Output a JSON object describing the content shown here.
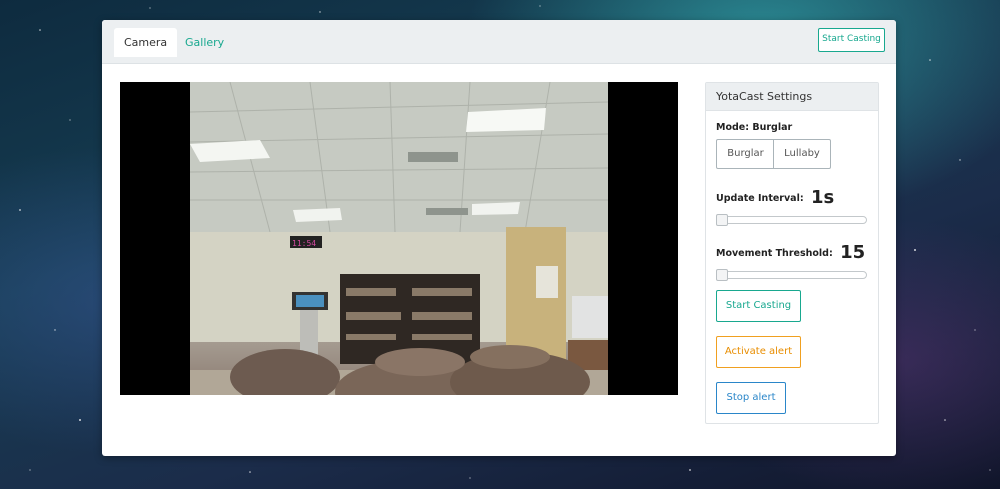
{
  "tabs": [
    {
      "label": "Camera",
      "active": true
    },
    {
      "label": "Gallery",
      "active": false
    }
  ],
  "header": {
    "start_casting_label": "Start Casting"
  },
  "video": {
    "clock_text": "11:54"
  },
  "settings": {
    "title": "YotaCast Settings",
    "mode_label": "Mode:",
    "mode_value": "Burglar",
    "mode_options": [
      "Burglar",
      "Lullaby"
    ],
    "update_interval_label": "Update Interval:",
    "update_interval_value": "1s",
    "update_interval_level": 0,
    "movement_threshold_label": "Movement Threshold:",
    "movement_threshold_value": "15",
    "movement_threshold_level": 0,
    "start_casting_label": "Start Casting",
    "activate_alert_label": "Activate alert",
    "stop_alert_label": "Stop alert"
  },
  "colors": {
    "accent_teal": "#18a88f",
    "alert_orange": "#f0a020",
    "stop_blue": "#2a86c9"
  }
}
